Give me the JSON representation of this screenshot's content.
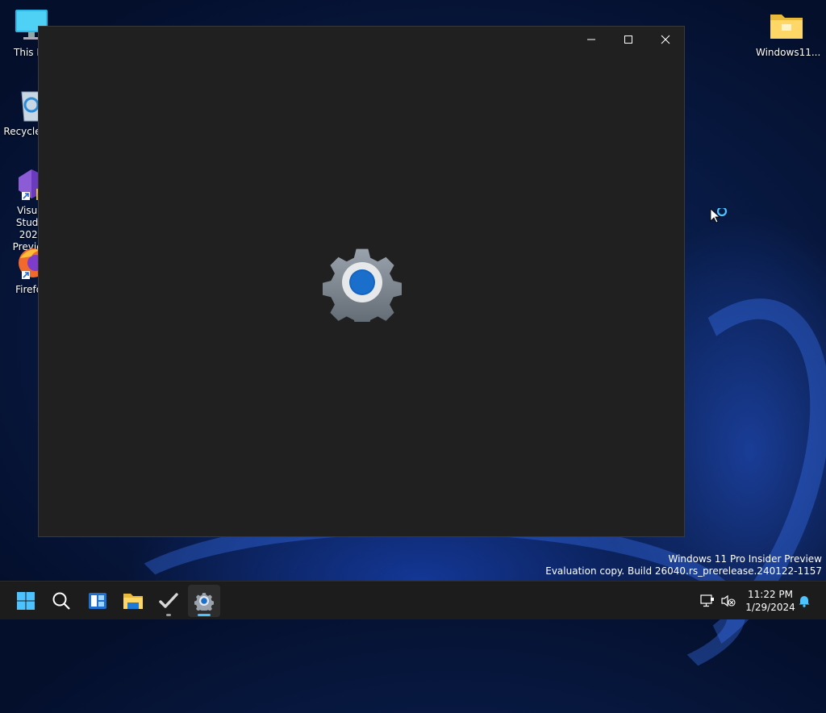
{
  "desktop": {
    "icons": [
      {
        "label": "This PC",
        "icon": "monitor-icon"
      },
      {
        "label": "Recycle Bin",
        "icon": "recycle-bin-icon"
      },
      {
        "label": "Visual Studio 2022 Preview",
        "label_line1": "Visual Studio",
        "label_line2": "2022 Preview",
        "icon": "visual-studio-icon",
        "badge": "PRE"
      },
      {
        "label": "Firefox",
        "icon": "firefox-icon"
      },
      {
        "label": "Windows11...",
        "icon": "folder-icon"
      }
    ]
  },
  "window": {
    "app": "Settings",
    "state": "loading",
    "splash_icon": "settings-gear-icon",
    "caption_buttons": [
      "minimize",
      "maximize",
      "close"
    ]
  },
  "watermark": {
    "line1": "Windows 11 Pro Insider Preview",
    "line2": "Evaluation copy. Build 26040.rs_prerelease.240122-1157"
  },
  "taskbar": {
    "items": [
      {
        "name": "Start",
        "icon": "windows-start-icon"
      },
      {
        "name": "Search",
        "icon": "search-icon"
      },
      {
        "name": "Widgets",
        "icon": "widgets-icon"
      },
      {
        "name": "File Explorer",
        "icon": "file-explorer-icon"
      },
      {
        "name": "Microsoft To Do",
        "icon": "checkmark-icon"
      },
      {
        "name": "Settings",
        "icon": "settings-gear-icon",
        "active": true
      }
    ],
    "tray": {
      "network_icon": "network-icon",
      "volume_icon": "volume-muted-icon",
      "notification_icon": "notification-bell-icon"
    },
    "clock": {
      "time": "11:22 PM",
      "date": "1/29/2024"
    }
  },
  "colors": {
    "accent": "#4cc2ff",
    "window_bg": "#202020",
    "taskbar_bg": "#1c1c1c"
  }
}
